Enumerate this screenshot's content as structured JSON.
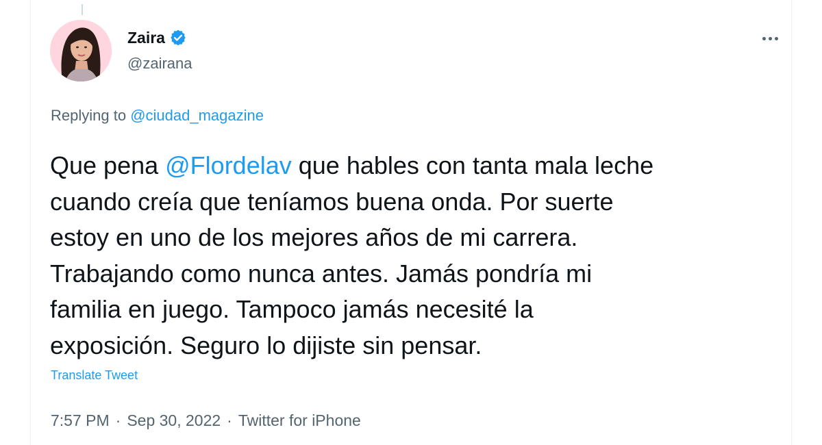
{
  "author": {
    "display_name": "Zaira",
    "handle": "@zairana",
    "verified": true
  },
  "reply": {
    "prefix": "Replying to",
    "to": "@ciudad_magazine"
  },
  "tweet": {
    "line1_a": "Que pena ",
    "mention": "@Flordelav",
    "line1_b": " que hables con tanta mala leche",
    "line2": "cuando creía que teníamos buena onda. Por suerte",
    "line3": "estoy en uno de los mejores años de mi carrera.",
    "line4": "Trabajando como nunca antes. Jamás pondría mi",
    "line5": "familia en juego. Tampoco jamás necesité la",
    "line6": "exposición. Seguro lo dijiste sin pensar."
  },
  "translate_label": "Translate Tweet",
  "meta": {
    "time": "7:57 PM",
    "date": "Sep 30, 2022",
    "source": "Twitter for iPhone",
    "separator": "·"
  },
  "colors": {
    "link": "#1d9bf0",
    "text": "#0f1419",
    "secondary": "#536471"
  },
  "icons": {
    "verified": "verified-badge-icon",
    "more": "more-options-icon"
  }
}
